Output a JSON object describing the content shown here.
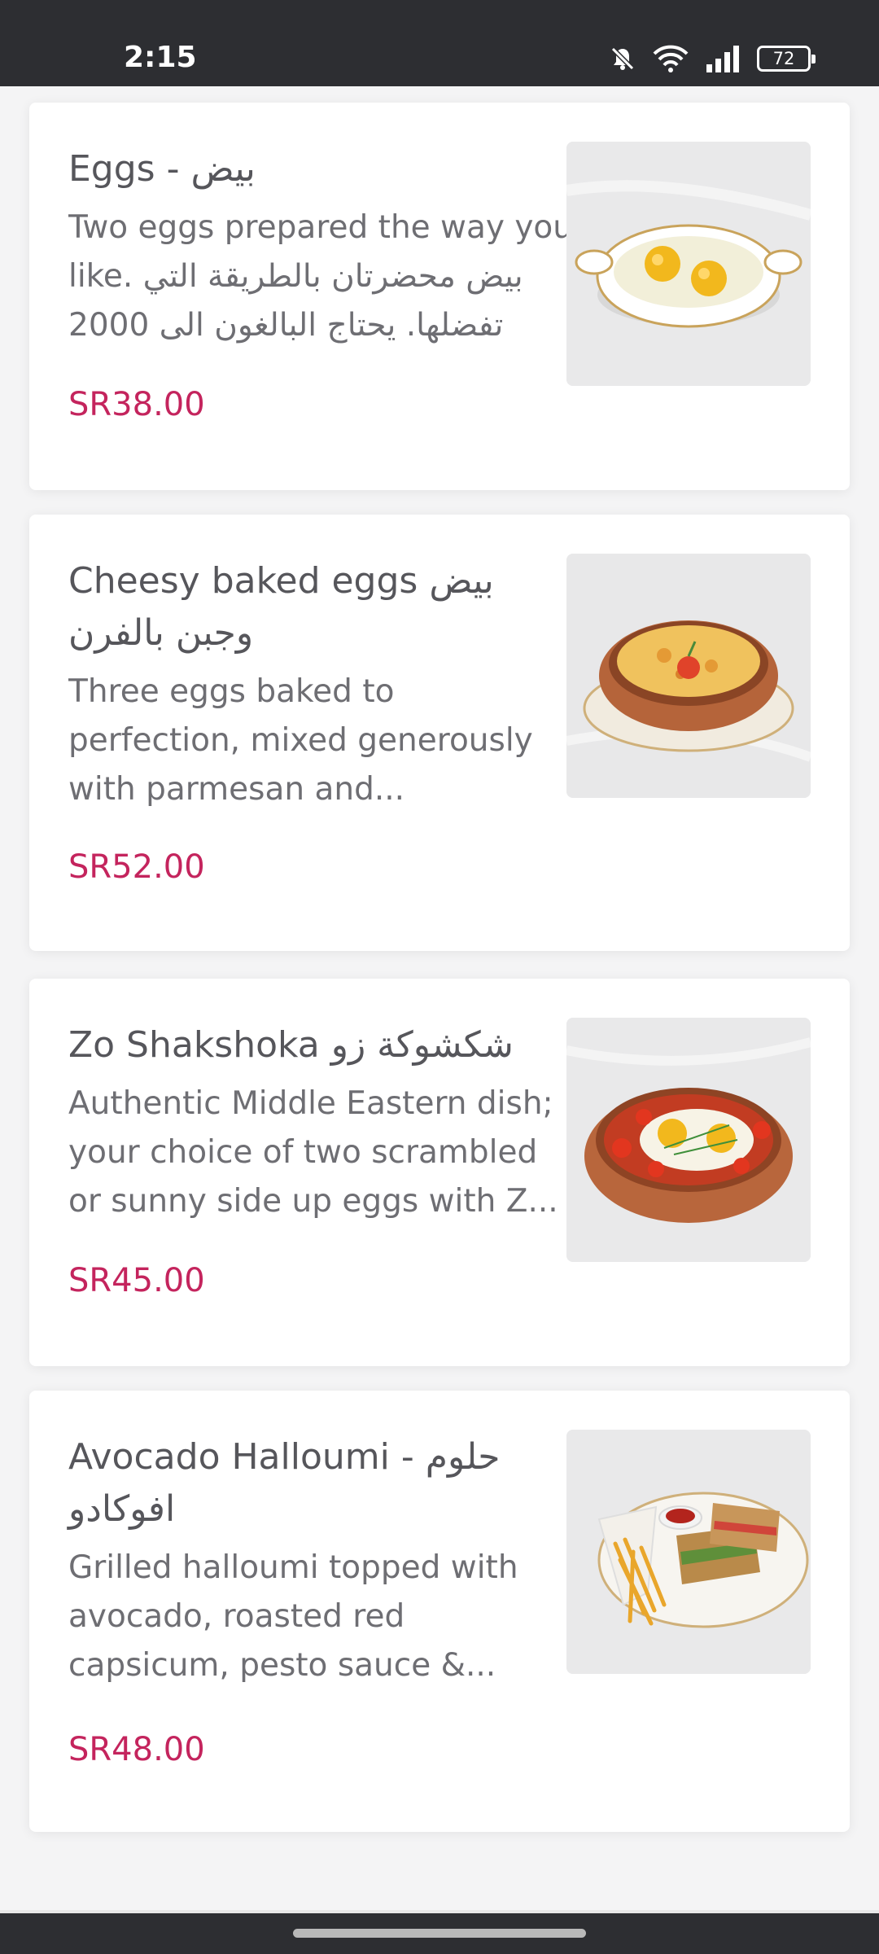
{
  "status_bar": {
    "time": "2:15",
    "battery": "72",
    "icons": [
      "bell-off-icon",
      "wifi-icon",
      "signal-icon",
      "battery-icon"
    ]
  },
  "colors": {
    "price": "#c4245d",
    "title": "#56565b",
    "description": "#6e6e73",
    "status_bar_bg": "#2d2e32"
  },
  "items": [
    {
      "name": "Eggs - بيض",
      "description": "Two eggs prepared the way you like. بيض محضرتان بالطريقة التي تفضلها. يحتاج البالغون الى 2000",
      "price": "SR38.00",
      "image": "fried-eggs-dish-image"
    },
    {
      "name": "Cheesy baked eggs بيض وجبن بالفرن",
      "description": "Three eggs baked to perfection, mixed generously with parmesan and...",
      "price": "SR52.00",
      "image": "cheesy-baked-eggs-image"
    },
    {
      "name": "Zo Shakshoka شكشوكة زو",
      "description": "Authentic Middle Eastern dish; your choice of two scrambled or sunny side up eggs with Z...",
      "price": "SR45.00",
      "image": "shakshoka-image"
    },
    {
      "name": "Avocado Halloumi - حلوم افوكادو",
      "description": "Grilled halloumi topped with avocado, roasted red capsicum, pesto sauce &...",
      "price": "SR48.00",
      "image": "halloumi-sandwich-image"
    }
  ]
}
